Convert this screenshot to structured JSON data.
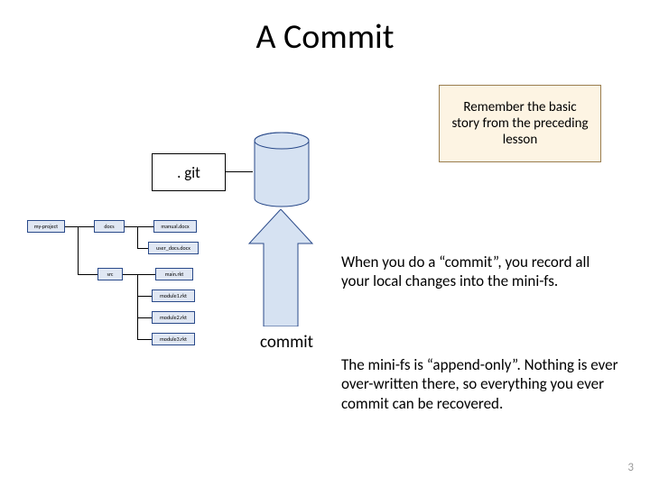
{
  "title": "A Commit",
  "git_label": ". git",
  "callout": "Remember the basic story from the preceding lesson",
  "tree": {
    "root": "my-project",
    "docs": "docs",
    "manual": "manual.docx",
    "user_docs": "user_docs.docx",
    "src": "src",
    "main": "main.rkt",
    "m1": "module1.rkt",
    "m2": "module2.rkt",
    "m3": "module3.rkt"
  },
  "commit_label": "commit",
  "para1": "When you do a “commit”, you record all your local changes into the mini-fs.",
  "para2": "The mini-fs is “append-only”. Nothing is ever over-written there, so everything you ever commit can be recovered.",
  "page": "3"
}
